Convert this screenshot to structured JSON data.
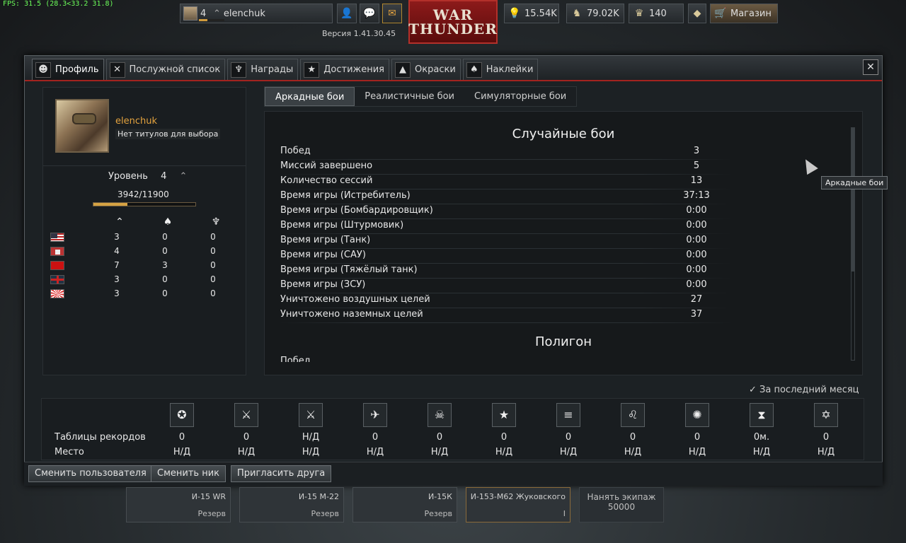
{
  "fps": "FPS: 31.5 (28.3<33.2 31.8)",
  "topbar": {
    "level": "4",
    "username": "elenchuk",
    "version": "Версия 1.41.30.45",
    "logo_line1": "WAR",
    "logo_line2": "THUNDER",
    "silver_lions": "15.54K",
    "research": "79.02K",
    "golden_eagles": "140",
    "shop": "Магазин"
  },
  "tabs": [
    {
      "label": "Профиль"
    },
    {
      "label": "Послужной список"
    },
    {
      "label": "Награды"
    },
    {
      "label": "Достижения"
    },
    {
      "label": "Окраски"
    },
    {
      "label": "Наклейки"
    }
  ],
  "close": "✕",
  "profile": {
    "name": "elenchuk",
    "title": "Нет титулов для выбора",
    "level_label": "Уровень",
    "level": "4",
    "xp": "3942/11900",
    "xp_progress": 0.331,
    "nations": [
      {
        "flag": "usa",
        "c1": "3",
        "c2": "0",
        "c3": "0"
      },
      {
        "flag": "germany",
        "c1": "4",
        "c2": "0",
        "c3": "0"
      },
      {
        "flag": "ussr",
        "c1": "7",
        "c2": "3",
        "c3": "0"
      },
      {
        "flag": "britain",
        "c1": "3",
        "c2": "0",
        "c3": "0"
      },
      {
        "flag": "japan",
        "c1": "3",
        "c2": "0",
        "c3": "0"
      }
    ]
  },
  "modes": [
    "Аркадные бои",
    "Реалистичные бои",
    "Симуляторные бои"
  ],
  "stats": {
    "section1": "Случайные бои",
    "rows": [
      {
        "k": "Побед",
        "v": "3"
      },
      {
        "k": "Миссий завершено",
        "v": "5"
      },
      {
        "k": "Количество сессий",
        "v": "13"
      },
      {
        "k": "Время игры (Истребитель)",
        "v": "37:13"
      },
      {
        "k": "Время игры (Бомбардировщик)",
        "v": "0:00"
      },
      {
        "k": "Время игры (Штурмовик)",
        "v": "0:00"
      },
      {
        "k": "Время игры (Танк)",
        "v": "0:00"
      },
      {
        "k": "Время игры (САУ)",
        "v": "0:00"
      },
      {
        "k": "Время игры (Тяжёлый танк)",
        "v": "0:00"
      },
      {
        "k": "Время игры (ЗСУ)",
        "v": "0:00"
      },
      {
        "k": "Уничтожено воздушных целей",
        "v": "27"
      },
      {
        "k": "Уничтожено наземных целей",
        "v": "37"
      }
    ],
    "section2": "Полигон",
    "partial_row": "Побед"
  },
  "tooltip": "Аркадные бои",
  "records": {
    "month_toggle": "За последний месяц",
    "row1_label": "Таблицы рекордов",
    "row2_label": "Место",
    "cols": [
      {
        "icon": "star-badge-icon",
        "v1": "0",
        "v2": "Н/Д"
      },
      {
        "icon": "crossed-swords-icon",
        "v1": "0",
        "v2": "Н/Д"
      },
      {
        "icon": "crossed-sabers-icon",
        "v1": "Н/Д",
        "v2": "Н/Д"
      },
      {
        "icon": "plane-icon",
        "v1": "0",
        "v2": "Н/Д"
      },
      {
        "icon": "skull-icon",
        "v1": "0",
        "v2": "Н/Д"
      },
      {
        "icon": "three-stars-icon",
        "v1": "0",
        "v2": "Н/Д"
      },
      {
        "icon": "formation-icon",
        "v1": "0",
        "v2": "Н/Д"
      },
      {
        "icon": "lion-icon",
        "v1": "0",
        "v2": "Н/Д"
      },
      {
        "icon": "bulb-icon",
        "v1": "0",
        "v2": "Н/Д"
      },
      {
        "icon": "time-icon",
        "v1": "0м.",
        "v2": "Н/Д"
      },
      {
        "icon": "star-emblem-icon",
        "v1": "0",
        "v2": "Н/Д"
      }
    ]
  },
  "buttons": {
    "change_user": "Сменить пользователя",
    "change_nick": "Сменить ник",
    "invite": "Пригласить друга"
  },
  "slots": [
    {
      "name": "И-15 WR",
      "status": "Резерв"
    },
    {
      "name": "И-15 М-22",
      "status": "Резерв"
    },
    {
      "name": "И-15К",
      "status": "Резерв"
    },
    {
      "name": "И-153-М62 Жуковского",
      "status": "I"
    }
  ],
  "crew": {
    "label": "Нанять экипаж",
    "price": "50000"
  }
}
